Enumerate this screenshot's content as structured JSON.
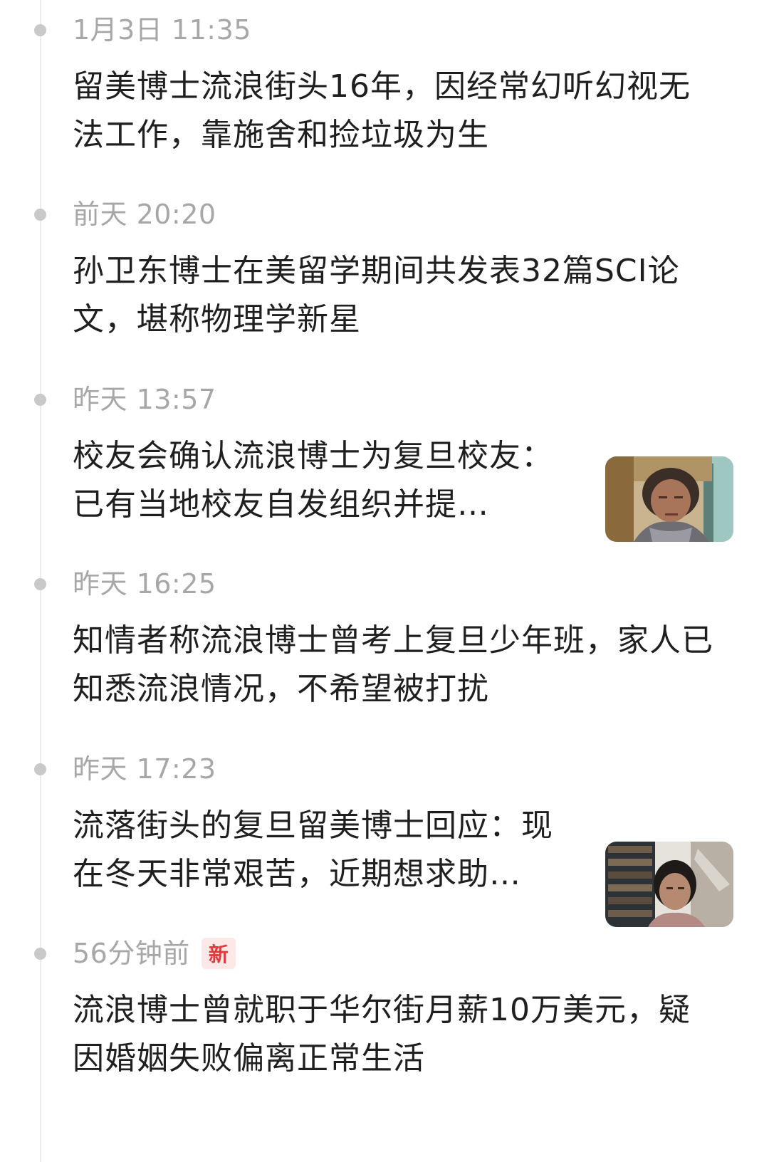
{
  "timeline": {
    "items": [
      {
        "time": "1月3日 11:35",
        "title": "留美博士流浪街头16年，因经常幻听幻视无法工作，靠施舍和捡垃圾为生"
      },
      {
        "time": "前天 20:20",
        "title": "孙卫东博士在美留学期间共发表32篇SCI论文，堪称物理学新星"
      },
      {
        "time": "昨天 13:57",
        "title": "校友会确认流浪博士为复旦校友：已有当地校友自发组织并提…"
      },
      {
        "time": "昨天 16:25",
        "title": "知情者称流浪博士曾考上复旦少年班，家人已知悉流浪情况，不希望被打扰"
      },
      {
        "time": "昨天 17:23",
        "title": "流落街头的复旦留美博士回应：现在冬天非常艰苦，近期想求助…"
      },
      {
        "time": "56分钟前",
        "badge": "新",
        "title": "流浪博士曾就职于华尔街月薪10万美元，疑因婚姻失败偏离正常生活"
      }
    ]
  },
  "colors": {
    "time_text": "#a7a7a7",
    "title_text": "#1f1f1f",
    "dot": "#c9c9c9",
    "line": "#ececec",
    "badge_bg": "#fde8e8",
    "badge_text": "#e0393e"
  }
}
